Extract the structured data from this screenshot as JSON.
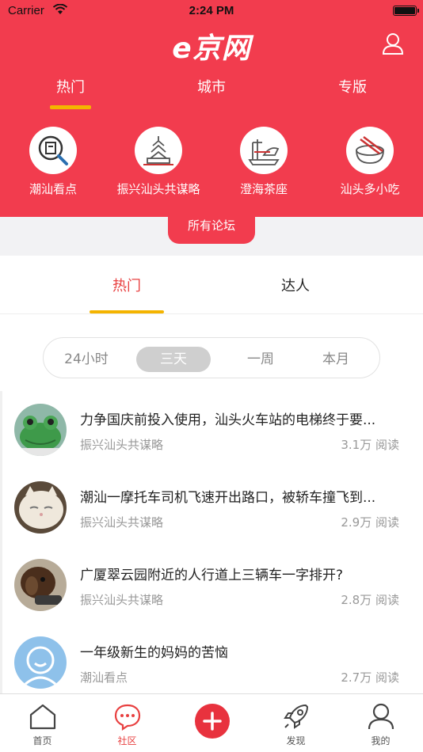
{
  "status_bar": {
    "carrier": "Carrier",
    "time": "2:24 PM"
  },
  "header": {
    "logo": "e京网",
    "tabs": [
      {
        "label": "热门",
        "active": true
      },
      {
        "label": "城市",
        "active": false
      },
      {
        "label": "专版",
        "active": false
      }
    ],
    "forums": [
      {
        "label": "潮汕看点",
        "icon": "magnifier-tag-icon"
      },
      {
        "label": "振兴汕头共谋略",
        "icon": "pagoda-icon"
      },
      {
        "label": "澄海茶座",
        "icon": "boat-harbor-icon"
      },
      {
        "label": "汕头多小吃",
        "icon": "bowl-chopsticks-icon"
      }
    ],
    "all_forums_label": "所有论坛"
  },
  "sub_tabs": [
    {
      "label": "热门",
      "active": true
    },
    {
      "label": "达人",
      "active": false
    }
  ],
  "period_filter": {
    "options": [
      "24小时",
      "三天",
      "一周",
      "本月"
    ],
    "selected": "三天"
  },
  "posts": [
    {
      "title": "力争国庆前投入使用，汕头火车站的电梯终于要...",
      "forum": "振兴汕头共谋略",
      "reads": "3.1万 阅读",
      "avatar": "frog-avatar"
    },
    {
      "title": "潮汕一摩托车司机飞速开出路口，被轿车撞飞到...",
      "forum": "振兴汕头共谋略",
      "reads": "2.9万 阅读",
      "avatar": "cat-avatar"
    },
    {
      "title": "广厦翠云园附近的人行道上三辆车一字排开?",
      "forum": "振兴汕头共谋略",
      "reads": "2.8万 阅读",
      "avatar": "dog-avatar"
    },
    {
      "title": "一年级新生的妈妈的苦恼",
      "forum": "潮汕看点",
      "reads": "2.7万 阅读",
      "avatar": "default-user-avatar"
    }
  ],
  "tab_bar": {
    "items": [
      {
        "label": "首页",
        "icon": "home-icon",
        "active": false
      },
      {
        "label": "社区",
        "icon": "chat-bubble-icon",
        "active": true
      },
      {
        "label": "",
        "icon": "plus-icon",
        "active": false
      },
      {
        "label": "发现",
        "icon": "rocket-icon",
        "active": false
      },
      {
        "label": "我的",
        "icon": "user-icon",
        "active": false
      }
    ]
  },
  "colors": {
    "brand_red": "#f23c4e",
    "accent_yellow": "#f4b400",
    "active_text": "#e84040"
  }
}
